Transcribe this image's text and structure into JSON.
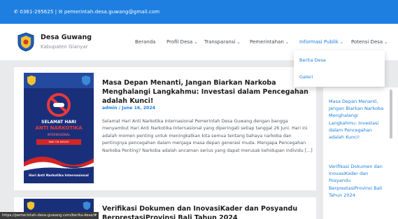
{
  "topbar": {
    "contact": "✆ 0361-295625 | ✉ pemerintah.desa.guwang@gmail.com"
  },
  "brand": {
    "name": "Desa Guwang",
    "subtitle": "Kabupaten Gianyar"
  },
  "nav": {
    "items": [
      {
        "label": "Beranda",
        "dropdown": false
      },
      {
        "label": "Profil Desa",
        "dropdown": true
      },
      {
        "label": "Transparansi",
        "dropdown": true
      },
      {
        "label": "Pemerintahan",
        "dropdown": true
      },
      {
        "label": "Informasi Publik",
        "dropdown": true,
        "active": true
      },
      {
        "label": "Potensi Desa",
        "dropdown": true
      }
    ],
    "chevron": "⌄"
  },
  "dropdown": {
    "items": [
      "Berita Desa",
      "Galeri"
    ]
  },
  "post1": {
    "title": "Masa Depan Menanti, Jangan Biarkan Narkoba Menghalangi Langkahmu: Investasi dalam Pencegahan adalah Kunci!",
    "meta": "admin / June 16, 2024",
    "excerpt": "Selamat Hari Anti Narkotika Internasional Pemerintah Desa Guwang dengan bangga menyambut Hari Anti Narkotika Internasional yang diperingati setiap tanggal 26 Juni. Hari ini adalah momen penting untuk meningkatkan kita semua tentang bahaya narkoba dan pentingnya pencegahan dalam menjaga masa depan generasi muda. Mengapa Pencegahan Narkoba Penting? Narkoba adalah ancaman serius yang dapat merusak kehidupan individu [...]",
    "thumb": {
      "line1": "SELAMAT HARI",
      "line2": "ANTI NARKOTIKA",
      "line3": "INTERNASIONAL",
      "banner": "WAR ON DRUGS",
      "caption": "Hari Anti Narkotika Internasional"
    }
  },
  "post2": {
    "title": "Verifikasi Dokumen dan InovasiKader dan Posyandu BerprestasiProvinsi Bali Tahun 2024"
  },
  "status_url": "https://pemerintah-desa-guwang.com/berita-desa/#",
  "sidebar": {
    "links": [
      "Masa Depan Menanti, Jangan Biarkan Narkoba Menghalangi Langkahmu: Investasi dalam Pencegahan adalah Kunci!",
      "Verifikasi Dokumen dan InovasiKader dan Posyandu BerprestasiProvinsi Bali Tahun 2024"
    ]
  },
  "colors": {
    "primary": "#1f7fe0",
    "topbar": "#1f7fe0",
    "background": "#e9eaec"
  }
}
